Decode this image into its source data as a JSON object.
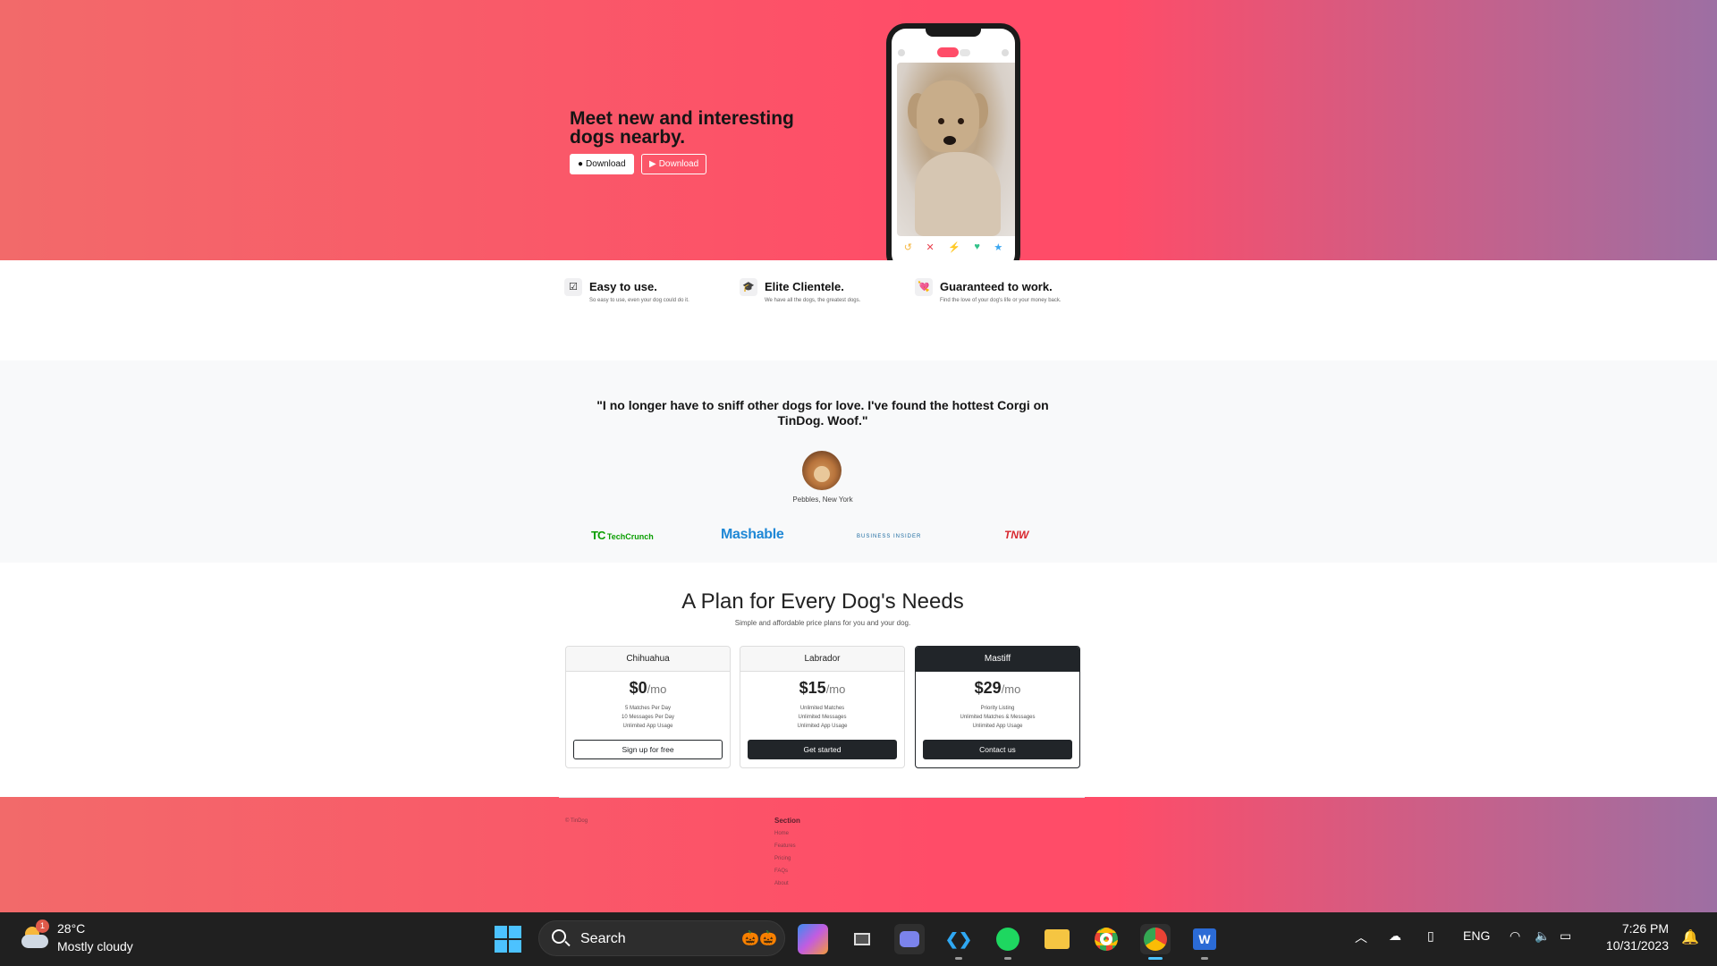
{
  "hero": {
    "title": "Meet new and interesting dogs nearby.",
    "apple_download": "Download",
    "play_download": "Download"
  },
  "phone": {
    "actions": [
      "↺",
      "✕",
      "⚡",
      "♥",
      "★"
    ]
  },
  "features": [
    {
      "icon": "check-circle-icon",
      "glyph": "☑",
      "title": "Easy to use.",
      "desc": "So easy to use, even your dog could do it."
    },
    {
      "icon": "graduation-cap-icon",
      "glyph": "🎓",
      "title": "Elite Clientele.",
      "desc": "We have all the dogs, the greatest dogs."
    },
    {
      "icon": "heart-arrow-icon",
      "glyph": "💘",
      "title": "Guaranteed to work.",
      "desc": "Find the love of your dog's life or your money back."
    }
  ],
  "testimonial": {
    "quote": "\"I no longer have to sniff other dogs for love. I've found the hottest Corgi on TinDog. Woof.\"",
    "author": "Pebbles, New York"
  },
  "press": {
    "techcrunch": "TechCrunch",
    "techcrunch_mark": "TC",
    "mashable": "Mashable",
    "business_insider": "BUSINESS INSIDER",
    "tnw": "TNW"
  },
  "pricing": {
    "title": "A Plan for Every Dog's Needs",
    "subtitle": "Simple and affordable price plans for you and your dog.",
    "plans": [
      {
        "name": "Chihuahua",
        "price": "$0",
        "period": "/mo",
        "features": [
          "5 Matches Per Day",
          "10 Messages Per Day",
          "Unlimited App Usage"
        ],
        "button": "Sign up for free"
      },
      {
        "name": "Labrador",
        "price": "$15",
        "period": "/mo",
        "features": [
          "Unlimited Matches",
          "Unlimited Messages",
          "Unlimited App Usage"
        ],
        "button": "Get started"
      },
      {
        "name": "Mastiff",
        "price": "$29",
        "period": "/mo",
        "features": [
          "Priority Listing",
          "Unlimited Matches & Messages",
          "Unlimited App Usage"
        ],
        "button": "Contact us"
      }
    ]
  },
  "footer": {
    "copyright": "© TinDog",
    "section_title": "Section",
    "links": [
      "Home",
      "Features",
      "Pricing",
      "FAQs",
      "About"
    ]
  },
  "taskbar": {
    "weather_badge": "1",
    "temperature": "28°C",
    "condition": "Mostly cloudy",
    "search_label": "Search",
    "language": "ENG",
    "time": "7:26 PM",
    "date": "10/31/2023"
  },
  "colors": {
    "brand_pink": "#ff4c68",
    "gradient_end": "#9d6fa3",
    "dark": "#212529",
    "accent_blue": "#4cc2ff"
  }
}
